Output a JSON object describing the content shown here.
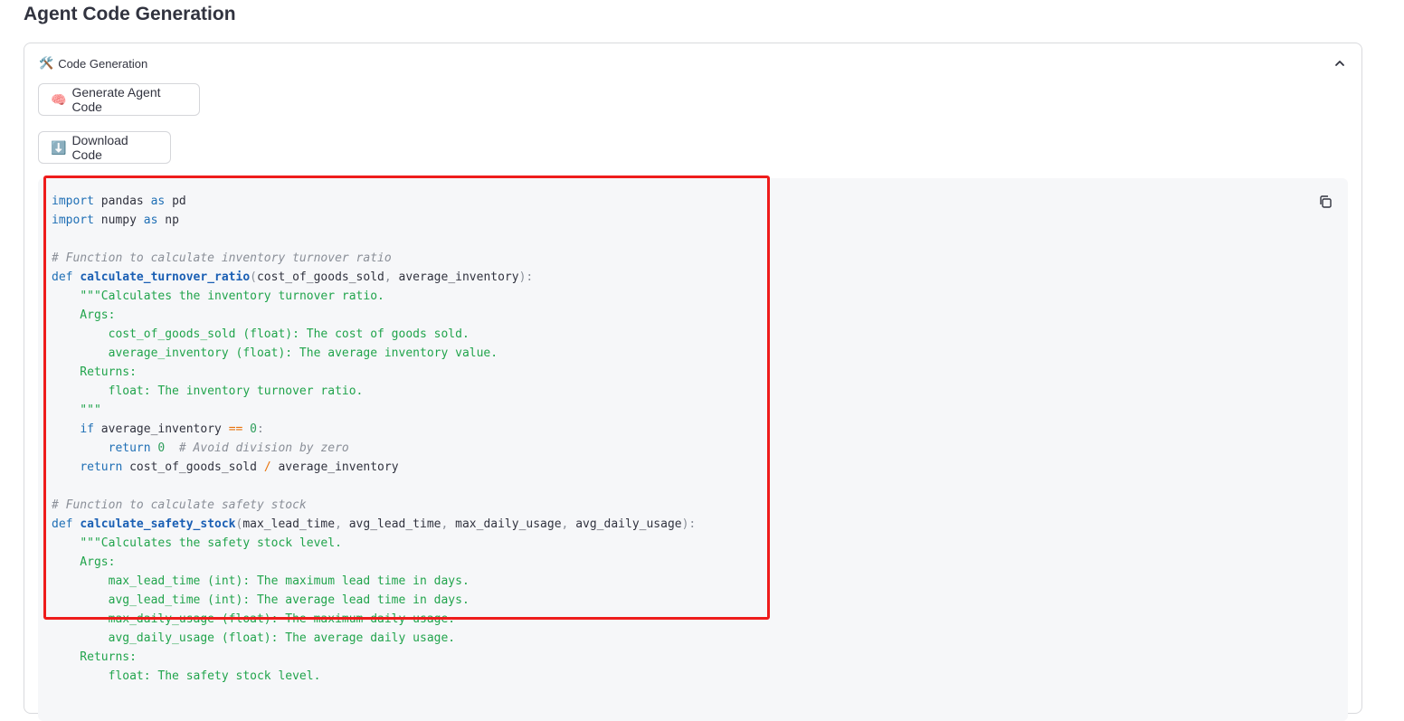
{
  "page": {
    "title": "Agent Code Generation"
  },
  "expander": {
    "icon": "🛠️",
    "label": "Code Generation",
    "state": "expanded"
  },
  "buttons": {
    "generate": {
      "icon": "🧠",
      "label": "Generate Agent Code"
    },
    "download": {
      "icon": "⬇️",
      "label": "Download Code"
    }
  },
  "code": {
    "language": "python",
    "lines": [
      [
        [
          "kw",
          "import"
        ],
        [
          "",
          " pandas "
        ],
        [
          "kw",
          "as"
        ],
        [
          "",
          " pd"
        ]
      ],
      [
        [
          "kw",
          "import"
        ],
        [
          "",
          " numpy "
        ],
        [
          "kw",
          "as"
        ],
        [
          "",
          " np"
        ]
      ],
      [],
      [
        [
          "cm",
          "# Function to calculate inventory turnover ratio"
        ]
      ],
      [
        [
          "kw",
          "def"
        ],
        [
          "",
          " "
        ],
        [
          "fn",
          "calculate_turnover_ratio"
        ],
        [
          "pn",
          "("
        ],
        [
          "",
          "cost_of_goods_sold"
        ],
        [
          "pn",
          ", "
        ],
        [
          "",
          "average_inventory"
        ],
        [
          "pn",
          "):"
        ]
      ],
      [
        [
          "",
          "    "
        ],
        [
          "st",
          "\"\"\"Calculates the inventory turnover ratio."
        ]
      ],
      [
        [
          "st",
          "    Args:"
        ]
      ],
      [
        [
          "st",
          "        cost_of_goods_sold (float): The cost of goods sold."
        ]
      ],
      [
        [
          "st",
          "        average_inventory (float): The average inventory value."
        ]
      ],
      [
        [
          "st",
          "    Returns:"
        ]
      ],
      [
        [
          "st",
          "        float: The inventory turnover ratio."
        ]
      ],
      [
        [
          "st",
          "    \"\"\""
        ]
      ],
      [
        [
          "",
          "    "
        ],
        [
          "kw",
          "if"
        ],
        [
          "",
          " average_inventory "
        ],
        [
          "op",
          "=="
        ],
        [
          "",
          " "
        ],
        [
          "nb",
          "0"
        ],
        [
          "pn",
          ":"
        ]
      ],
      [
        [
          "",
          "        "
        ],
        [
          "kw",
          "return"
        ],
        [
          "",
          " "
        ],
        [
          "nb",
          "0"
        ],
        [
          "",
          "  "
        ],
        [
          "cm",
          "# Avoid division by zero"
        ]
      ],
      [
        [
          "",
          "    "
        ],
        [
          "kw",
          "return"
        ],
        [
          "",
          " cost_of_goods_sold "
        ],
        [
          "op",
          "/"
        ],
        [
          "",
          " average_inventory"
        ]
      ],
      [],
      [
        [
          "cm",
          "# Function to calculate safety stock"
        ]
      ],
      [
        [
          "kw",
          "def"
        ],
        [
          "",
          " "
        ],
        [
          "fn",
          "calculate_safety_stock"
        ],
        [
          "pn",
          "("
        ],
        [
          "",
          "max_lead_time"
        ],
        [
          "pn",
          ", "
        ],
        [
          "",
          "avg_lead_time"
        ],
        [
          "pn",
          ", "
        ],
        [
          "",
          "max_daily_usage"
        ],
        [
          "pn",
          ", "
        ],
        [
          "",
          "avg_daily_usage"
        ],
        [
          "pn",
          "):"
        ]
      ],
      [
        [
          "",
          "    "
        ],
        [
          "st",
          "\"\"\"Calculates the safety stock level."
        ]
      ],
      [
        [
          "st",
          "    Args:"
        ]
      ],
      [
        [
          "st",
          "        max_lead_time (int): The maximum lead time in days."
        ]
      ],
      [
        [
          "st",
          "        avg_lead_time (int): The average lead time in days."
        ]
      ],
      [
        [
          "st",
          "        max_daily_usage (float): The maximum daily usage."
        ]
      ],
      [
        [
          "st",
          "        avg_daily_usage (float): The average daily usage."
        ]
      ],
      [
        [
          "st",
          "    Returns:"
        ]
      ],
      [
        [
          "st",
          "        float: The safety stock level."
        ]
      ]
    ]
  },
  "icons": {
    "expander": "tools-icon",
    "collapse": "chevron-up-icon",
    "copy": "copy-icon"
  },
  "colors": {
    "keyword": "#1f6fb5",
    "function": "#1a5fb4",
    "comment": "#8a8f98",
    "string": "#21a44c",
    "operator": "#e8730c",
    "highlight": "#ee1c1c"
  }
}
